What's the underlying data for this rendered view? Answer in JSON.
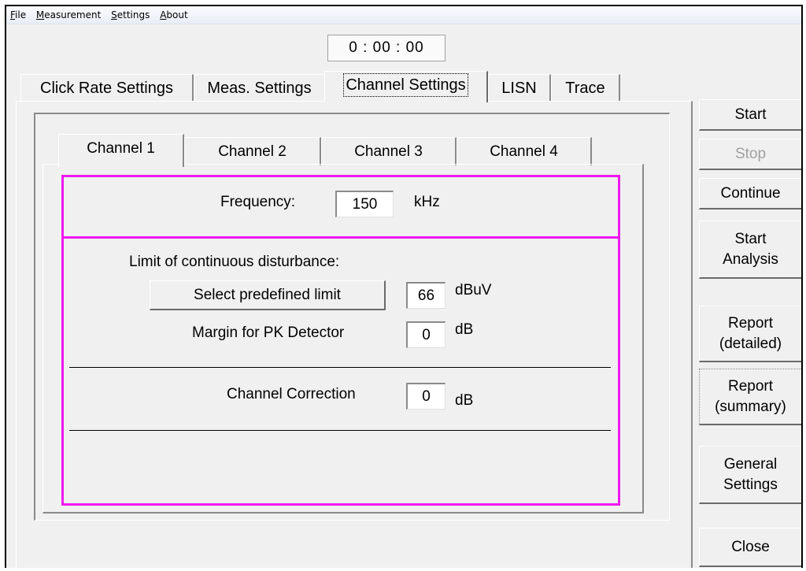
{
  "menu": {
    "file": {
      "mnemonic": "F",
      "rest": "ile"
    },
    "measurement": {
      "mnemonic": "M",
      "rest": "easurement"
    },
    "settings": {
      "mnemonic": "S",
      "rest": "ettings"
    },
    "about": {
      "mnemonic": "A",
      "rest": "bout"
    }
  },
  "timer": "0 : 00 : 00",
  "outer_tabs": {
    "click_rate": "Click Rate Settings",
    "meas": "Meas. Settings",
    "channel": "Channel Settings",
    "lisn": "LISN",
    "trace": "Trace",
    "active": "Channel Settings"
  },
  "channel_tabs": {
    "ch1": "Channel  1",
    "ch2": "Channel  2",
    "ch3": "Channel  3",
    "ch4": "Channel  4",
    "active": "Channel  1"
  },
  "frequency": {
    "label": "Frequency:",
    "value": "150",
    "unit": "kHz"
  },
  "limit": {
    "heading": "Limit of continuous disturbance:",
    "select_button": "Select predefined limit",
    "value": "66",
    "unit": "dBuV",
    "margin_label": "Margin for PK Detector",
    "margin_value": "0",
    "margin_unit": "dB"
  },
  "correction": {
    "label": "Channel Correction",
    "value": "0",
    "unit": "dB"
  },
  "side_buttons": {
    "start": "Start",
    "stop": "Stop",
    "continue": "Continue",
    "start_analysis": "Start\nAnalysis",
    "report_detailed": "Report\n(detailed)",
    "report_summary": "Report\n(summary)",
    "general_settings": "General\nSettings",
    "close": "Close"
  },
  "colors": {
    "accent": "#ee19ee",
    "disabled_text": "#a0a0a0",
    "window_bg": "#f0f0f0"
  }
}
